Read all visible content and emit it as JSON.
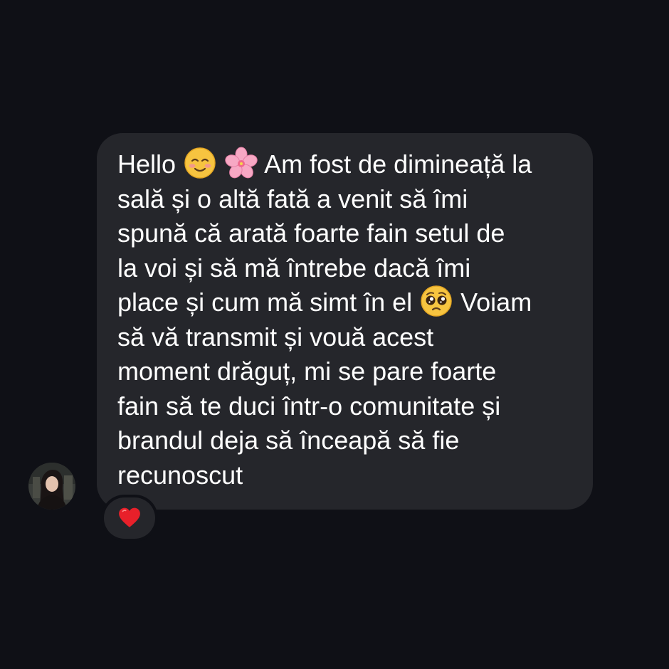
{
  "message": {
    "lines": [
      {
        "before": "Hello ",
        "emoji1": "smiling-face-icon",
        "emoji2": "cherry-blossom-icon",
        "after": " Am fost de dimineață la"
      },
      {
        "text": "sală și o altă fată a venit să îmi"
      },
      {
        "text": "spună că arată foarte fain setul de"
      },
      {
        "text": "la voi și să mă întrebe dacă îmi"
      },
      {
        "before": "place și cum mă simt în el ",
        "emoji1": "pleading-face-icon",
        "after": " Voiam"
      },
      {
        "text": "să vă transmit și vouă acest"
      },
      {
        "text": "moment drăguț, mi se pare foarte"
      },
      {
        "text": "fain să te duci într-o comunitate și"
      },
      {
        "text": "brandul deja să înceapă să fie"
      },
      {
        "text": "recunoscut"
      }
    ]
  },
  "reaction": {
    "icon": "red-heart-icon"
  },
  "colors": {
    "background": "#0f1016",
    "bubble": "#25262b",
    "text": "#ffffff",
    "heart": "#e8202a"
  }
}
